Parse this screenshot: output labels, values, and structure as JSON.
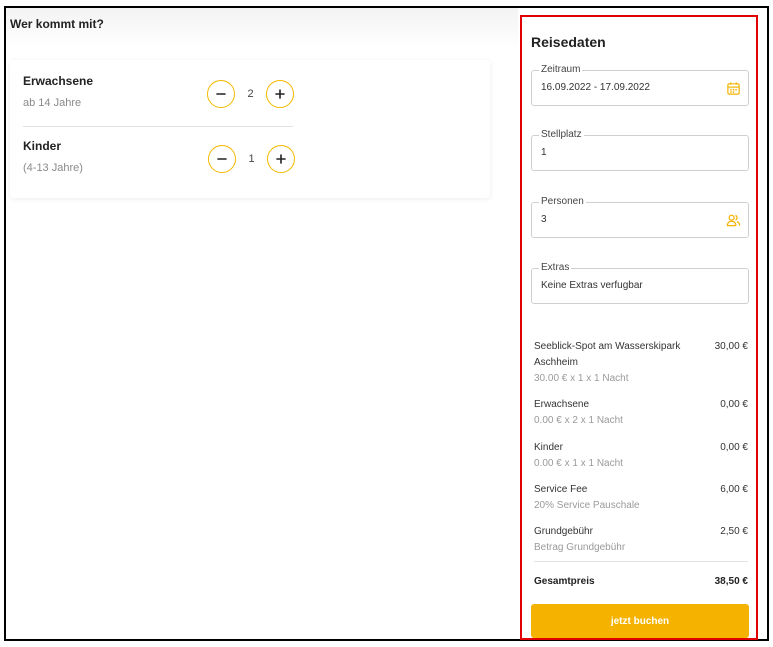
{
  "guests": {
    "title": "Wer kommt mit?",
    "rows": [
      {
        "label": "Erwachsene",
        "sub": "ab 14 Jahre",
        "count": "2"
      },
      {
        "label": "Kinder",
        "sub": "(4-13 Jahre)",
        "count": "1"
      }
    ]
  },
  "sidebar": {
    "title": "Reisedaten",
    "fields": [
      {
        "legend": "Zeitraum",
        "value": "16.09.2022 - 17.09.2022",
        "icon": "calendar-icon"
      },
      {
        "legend": "Stellplatz",
        "value": "1"
      },
      {
        "legend": "Personen",
        "value": "3",
        "icon": "users-icon"
      },
      {
        "legend": "Extras",
        "value": "Keine Extras verfugbar"
      }
    ],
    "prices": [
      {
        "name": "Seeblick-Spot am Wasserskipark Aschheim",
        "detail": "30.00 € x 1 x 1 Nacht",
        "amount": "30,00 €"
      },
      {
        "name": "Erwachsene",
        "detail": "0.00 € x 2 x 1 Nacht",
        "amount": "0,00 €"
      },
      {
        "name": "Kinder",
        "detail": "0.00 € x 1 x 1 Nacht",
        "amount": "0,00 €"
      },
      {
        "name": "Service Fee",
        "detail": "20% Service Pauschale",
        "amount": "6,00 €"
      },
      {
        "name": "Grundgebühr",
        "detail": "Betrag Grundgebühr",
        "amount": "2,50 €"
      }
    ],
    "total": {
      "label": "Gesamtpreis",
      "amount": "38,50 €"
    },
    "book_label": "jetzt buchen"
  },
  "colors": {
    "accent": "#f5b300",
    "highlight_border": "#e00000"
  }
}
